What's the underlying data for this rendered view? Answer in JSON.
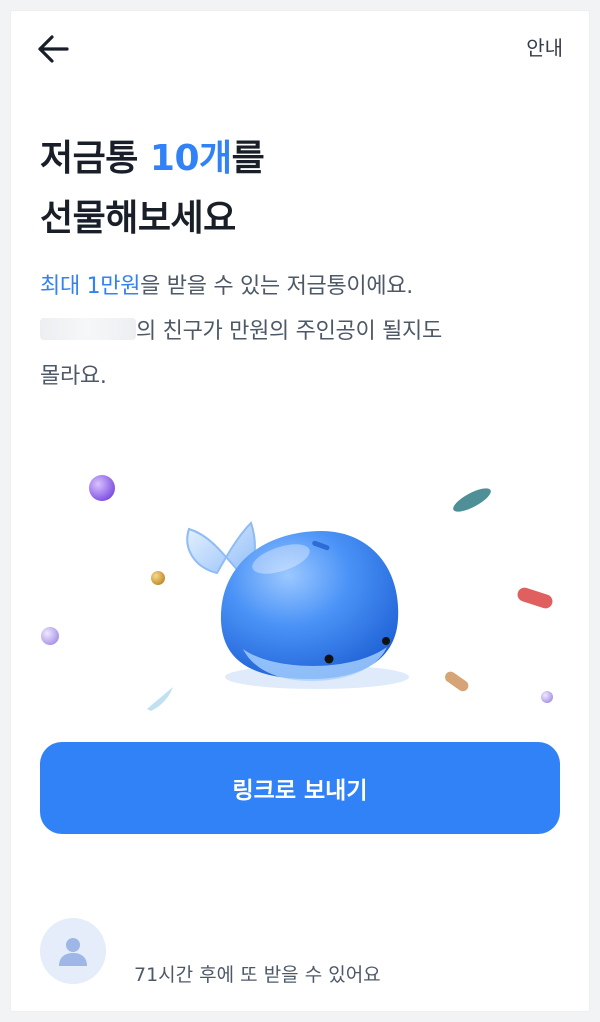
{
  "header": {
    "back_icon": "arrow-left-icon",
    "guide_label": "안내"
  },
  "headline": {
    "line1_prefix": "저금통 ",
    "line1_accent": "10개",
    "line1_suffix": "를",
    "line2": "선물해보세요"
  },
  "description": {
    "line1_accent": "최대 1만원",
    "line1_rest": "을 받을 수 있는 저금통이에요.",
    "line2_rest": "의 친구가 만원의 주인공이 될지도",
    "line3": "몰라요."
  },
  "illustration": {
    "icon": "whale-piggy-bank-icon"
  },
  "cta": {
    "send_link_label": "링크로 보내기"
  },
  "footer": {
    "avatar_icon": "user-avatar-icon",
    "cooldown_text": "71시간 후에 또 받을 수 있어요"
  },
  "colors": {
    "accent": "#3182f6",
    "title": "#191f28",
    "body": "#4e5968"
  }
}
